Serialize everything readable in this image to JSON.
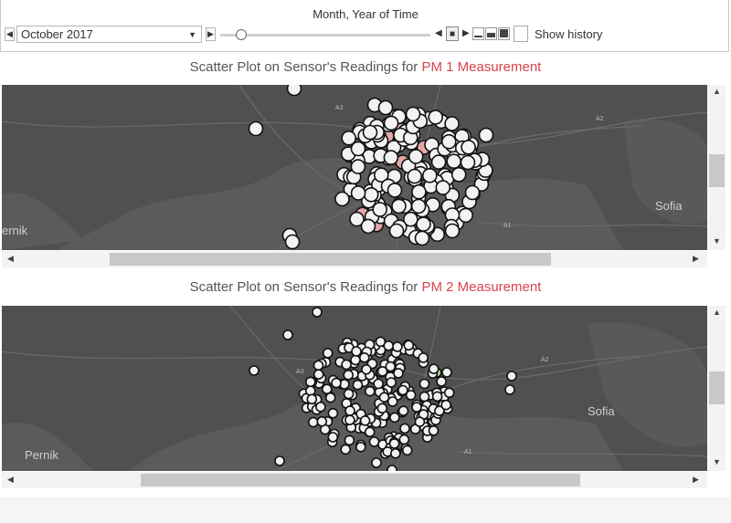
{
  "controls": {
    "title": "Month, Year of Time",
    "selected_month": "October 2017",
    "show_history_label": "Show history",
    "prev_glyph": "◀",
    "next_glyph": "▶",
    "caret_glyph": "▼",
    "play_back_glyph": "◀",
    "stop_glyph": "■",
    "play_glyph": "▶"
  },
  "charts": [
    {
      "title_prefix": "Scatter Plot on  Sensor's Readings for ",
      "title_accent": "PM 1 Measurement",
      "map_labels": {
        "city_left": "ernik",
        "city_right": "Sofia",
        "road_a": "A1",
        "road_b": "A2",
        "road_c": "A3"
      }
    },
    {
      "title_prefix": "Scatter Plot on  Sensor's Readings for ",
      "title_accent": "PM 2 Measurement",
      "map_labels": {
        "city_left": "Pernik",
        "city_right": "Sofia",
        "road_a": "A1",
        "road_b": "A2",
        "road_c": "A3"
      }
    }
  ],
  "colors": {
    "map_bg": "#505050",
    "urban": "#5c5c5c",
    "road": "#6a6a6a",
    "point": "#f2f2f2",
    "point_stroke": "#111111",
    "pm1_highlight": "#e4a7a7",
    "pm2_highlight": "#b9e3b0",
    "accent": "#d9434d"
  }
}
